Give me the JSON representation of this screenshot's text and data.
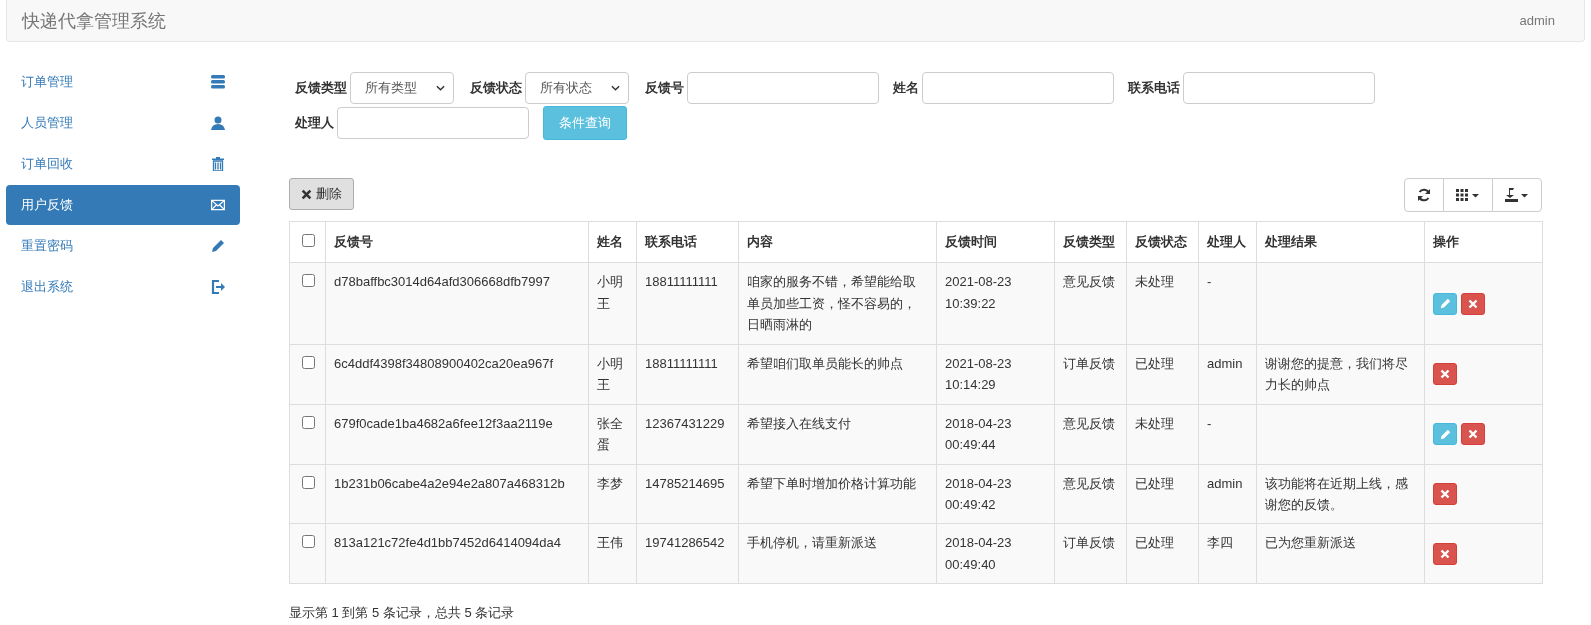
{
  "navbar": {
    "brand": "快递代拿管理系统",
    "user": "admin"
  },
  "sidebar": {
    "items": [
      {
        "label": "订单管理",
        "selected": false
      },
      {
        "label": "人员管理",
        "selected": false
      },
      {
        "label": "订单回收",
        "selected": false
      },
      {
        "label": "用户反馈",
        "selected": true
      },
      {
        "label": "重置密码",
        "selected": false
      },
      {
        "label": "退出系统",
        "selected": false
      }
    ]
  },
  "filters": [
    {
      "kind": "select",
      "label": "反馈类型",
      "value": "所有类型"
    },
    {
      "kind": "select",
      "label": "反馈状态",
      "value": "所有状态"
    },
    {
      "kind": "input",
      "label": "反馈号"
    },
    {
      "kind": "input",
      "label": "姓名"
    },
    {
      "kind": "input",
      "label": "联系电话"
    },
    {
      "kind": "input",
      "label": "处理人"
    }
  ],
  "search_button": "条件查询",
  "delete_button": "删除",
  "table": {
    "select_all_checked": false,
    "columns": [
      "反馈号",
      "姓名",
      "联系电话",
      "内容",
      "反馈时间",
      "反馈类型",
      "反馈状态",
      "处理人",
      "处理结果",
      "操作"
    ],
    "rows": [
      {
        "checked": false,
        "cells": [
          "d78baffbc3014d64afd306668dfb7997",
          "小明王",
          "18811111111",
          "咱家的服务不错，希望能给取单员加些工资，怪不容易的，日晒雨淋的",
          "2021-08-23 10:39:22",
          "意见反馈",
          "未处理",
          "-",
          ""
        ],
        "actions": [
          {
            "kind": "edit"
          },
          {
            "kind": "delete"
          }
        ]
      },
      {
        "checked": false,
        "cells": [
          "6c4ddf4398f34808900402ca20ea967f",
          "小明王",
          "18811111111",
          "希望咱们取单员能长的帅点",
          "2021-08-23 10:14:29",
          "订单反馈",
          "已处理",
          "admin",
          "谢谢您的提意，我们将尽力长的帅点"
        ],
        "actions": [
          {
            "kind": "delete"
          }
        ]
      },
      {
        "checked": false,
        "cells": [
          "679f0cade1ba4682a6fee12f3aa2119e",
          "张全蛋",
          "12367431229",
          "希望接入在线支付",
          "2018-04-23 00:49:44",
          "意见反馈",
          "未处理",
          "-",
          ""
        ],
        "actions": [
          {
            "kind": "edit"
          },
          {
            "kind": "delete"
          }
        ]
      },
      {
        "checked": false,
        "cells": [
          "1b231b06cabe4a2e94e2a807a468312b",
          "李梦",
          "14785214695",
          "希望下单时增加价格计算功能",
          "2018-04-23 00:49:42",
          "意见反馈",
          "已处理",
          "admin",
          "该功能将在近期上线，感谢您的反馈。"
        ],
        "actions": [
          {
            "kind": "delete"
          }
        ]
      },
      {
        "checked": false,
        "cells": [
          "813a121c72fe4d1bb7452d6414094da4",
          "王伟",
          "19741286542",
          "手机停机，请重新派送",
          "2018-04-23 00:49:40",
          "订单反馈",
          "已处理",
          "李四",
          "已为您重新派送"
        ],
        "actions": [
          {
            "kind": "delete"
          }
        ]
      }
    ]
  },
  "pagination_info": "显示第 1 到第 5 条记录，总共 5 条记录"
}
